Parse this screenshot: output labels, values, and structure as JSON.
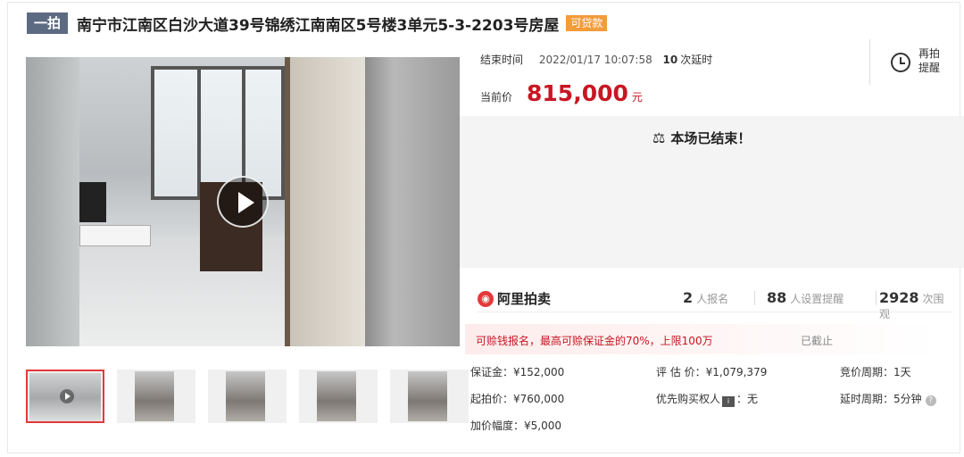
{
  "header": {
    "round_badge": "一拍",
    "title": "南宁市江南区白沙大道39号锦绣江南南区5号楼3单元5-3-2203号房屋",
    "loan_tag": "可贷款"
  },
  "auction": {
    "end_time_label": "结束时间",
    "end_time": "2022/01/17 10:07:58",
    "extend_count": "10",
    "extend_unit": "次延时",
    "price_label": "当前价",
    "price": "815,000",
    "price_unit": "元",
    "remind_label": "再拍提醒",
    "ended_message": "本场已结束！"
  },
  "stats": {
    "logo": "阿里拍卖",
    "signups": "2",
    "signups_label": "人报名",
    "reminders": "88",
    "reminders_label": "人设置提醒",
    "views": "2928",
    "views_label": "次围观"
  },
  "deposit": {
    "note": "可赊钱报名，最高可赊保证金的70%，上限100万",
    "status": "已截止"
  },
  "params": {
    "deposit": "保证金：¥152,000",
    "valuation": "评 估 价：¥1,079,379",
    "bid_cycle": "竞价周期：1天",
    "start_price": "起拍价：¥760,000",
    "priority_prefix": "优先购买权人",
    "priority_value": "：无",
    "delay_cycle": "延时周期：5分钟",
    "increment": "加价幅度：¥5,000"
  },
  "gallery": {
    "thumbnails": [
      "thumb-1",
      "thumb-2",
      "thumb-3",
      "thumb-4",
      "thumb-5"
    ],
    "active_index": 0
  },
  "colors": {
    "accent": "#c81623",
    "badge": "#5d6b82",
    "loan": "#f39c3a"
  }
}
